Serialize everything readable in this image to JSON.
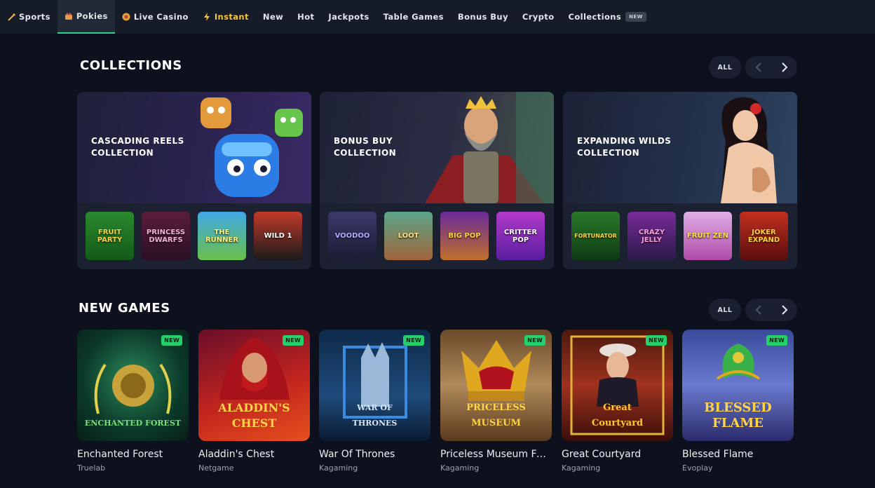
{
  "nav": [
    {
      "label": "Sports",
      "icon": "sports-icon"
    },
    {
      "label": "Pokies",
      "icon": "pokies-icon"
    },
    {
      "label": "Live Casino",
      "icon": "live-casino-icon"
    },
    {
      "label": "Instant",
      "icon": "lightning-icon"
    },
    {
      "label": "New"
    },
    {
      "label": "Hot"
    },
    {
      "label": "Jackpots"
    },
    {
      "label": "Table Games"
    },
    {
      "label": "Bonus Buy"
    },
    {
      "label": "Crypto"
    },
    {
      "label": "Collections",
      "badge": "NEW"
    }
  ],
  "nav_active": "Pokies",
  "collections": {
    "title": "COLLECTIONS",
    "all_label": "ALL",
    "cards": [
      {
        "title_line1": "CASCADING REELS",
        "title_line2": "COLLECTION",
        "thumbs": [
          "FRUIT PARTY",
          "PRINCESS DWARFS",
          "THE RUNNER",
          "WILD 1"
        ]
      },
      {
        "title_line1": "BONUS BUY",
        "title_line2": "COLLECTION",
        "thumbs": [
          "VOODOO",
          "LOOT",
          "BIG POP",
          "CRITTER POP"
        ]
      },
      {
        "title_line1": "EXPANDING WILDS",
        "title_line2": "COLLECTION",
        "thumbs": [
          "FORTUNATOR",
          "CRAZY JELLY",
          "FRUIT ZEN",
          "JOKER EXPAND"
        ]
      }
    ]
  },
  "new_games": {
    "title": "NEW GAMES",
    "all_label": "ALL",
    "badge": "NEW",
    "games": [
      {
        "name": "Enchanted Forest",
        "provider": "Truelab",
        "logo": "ENCHANTED FOREST"
      },
      {
        "name": "Aladdin's Chest",
        "provider": "Netgame",
        "logo": "ALADDIN'S CHEST"
      },
      {
        "name": "War Of Thrones",
        "provider": "Kagaming",
        "logo": "WAR OF THRONES"
      },
      {
        "name": "Priceless Museum Fu...",
        "provider": "Kagaming",
        "logo": "PRICELESS MUSEUM"
      },
      {
        "name": "Great Courtyard",
        "provider": "Kagaming",
        "logo": "Great Courtyard"
      },
      {
        "name": "Blessed Flame",
        "provider": "Evoplay",
        "logo": "BLESSED FLAME"
      }
    ]
  },
  "colors": {
    "accent": "#2fd58a",
    "badge": "#25cf6c",
    "background": "#0c111d",
    "instant": "#f4c542"
  }
}
